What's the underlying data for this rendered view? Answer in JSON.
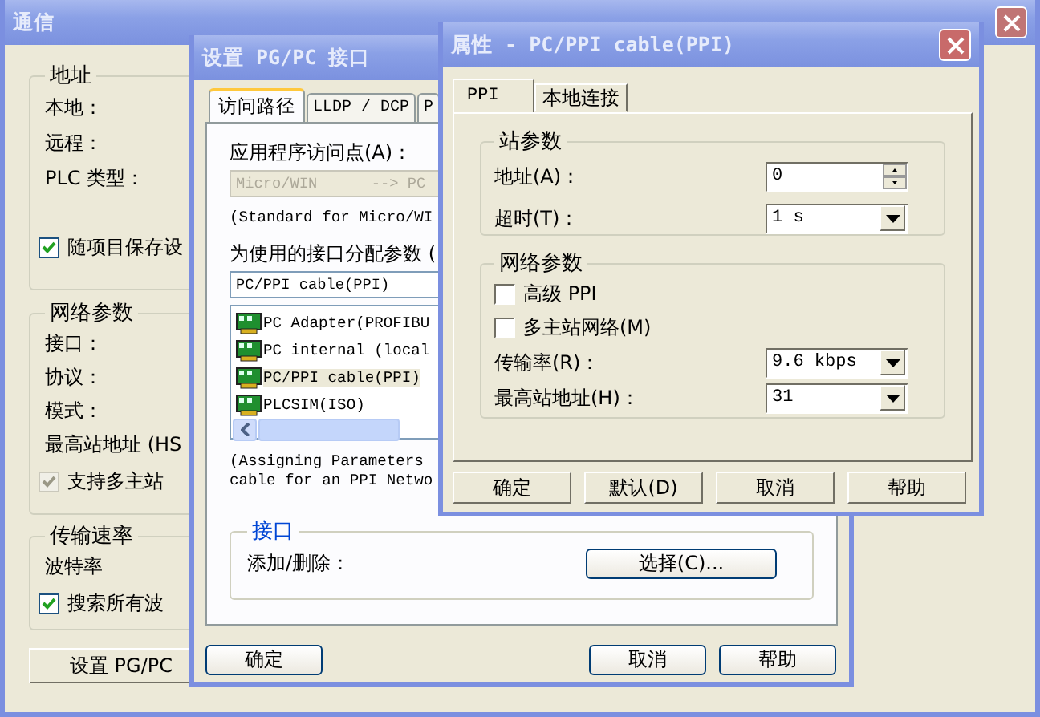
{
  "communication_dialog": {
    "title": "通信",
    "address_group": {
      "title": "地址",
      "labels": [
        "本地：",
        "远程：",
        "PLC 类型："
      ],
      "save_checkbox": {
        "label": "随项目保存设",
        "checked": true,
        "disabled": false
      }
    },
    "network_group": {
      "title": "网络参数",
      "labels": [
        "接口：",
        "协议：",
        "模式：",
        "最高站地址 (HS"
      ],
      "multi_master": {
        "label": "支持多主站",
        "checked": true,
        "disabled": true
      }
    },
    "rate_group": {
      "title": "传输速率",
      "labels": [
        "波特率"
      ],
      "search_all": {
        "label": "搜索所有波",
        "checked": true,
        "disabled": false
      }
    },
    "setup_button": "设置 PG/PC"
  },
  "pgpc_dialog": {
    "title": "设置 PG/PC 接口",
    "tabs": [
      {
        "label": "访问路径",
        "selected": true
      },
      {
        "label": "LLDP / DCP",
        "selected": false
      },
      {
        "label": "P",
        "selected": false
      }
    ],
    "access_point_label": "应用程序访问点(A)：",
    "access_point_field": {
      "value": "Micro/WIN      --> PC",
      "disabled": true
    },
    "access_point_note": "(Standard for Micro/WI",
    "param_label": "为使用的接口分配参数 (",
    "param_field": "PC/PPI cable(PPI)",
    "interfaces": [
      {
        "label": "PC Adapter(PROFIBU",
        "selected": false
      },
      {
        "label": "PC internal (local",
        "selected": false
      },
      {
        "label": "PC/PPI cable(PPI)",
        "selected": true
      },
      {
        "label": "PLCSIM(ISO)",
        "selected": false
      }
    ],
    "description": [
      "(Assigning Parameters",
      "cable for an PPI Netwo"
    ],
    "interface_group": {
      "title": "接口",
      "label": "添加/删除：",
      "button": "选择(C)..."
    },
    "buttons": [
      "确定",
      "取消",
      "帮助"
    ]
  },
  "properties_dialog": {
    "title": "属性 - PC/PPI cable(PPI)",
    "tabs": [
      {
        "label": "PPI",
        "selected": true
      },
      {
        "label": "本地连接",
        "selected": false
      }
    ],
    "station_group": {
      "title": "站参数",
      "address": {
        "label": "地址(A)：",
        "value": "0"
      },
      "timeout": {
        "label": "超时(T)：",
        "value": "1 s"
      }
    },
    "network_group": {
      "title": "网络参数",
      "advanced_ppi": {
        "label": "高级 PPI",
        "checked": false
      },
      "multi_master": {
        "label": "多主站网络(M)",
        "checked": false
      },
      "rate": {
        "label": "传输率(R)：",
        "value": "9.6 kbps"
      },
      "hsa": {
        "label": "最高站地址(H)：",
        "value": "31"
      }
    },
    "buttons": [
      "确定",
      "默认(D)",
      "取消",
      "帮助"
    ]
  }
}
